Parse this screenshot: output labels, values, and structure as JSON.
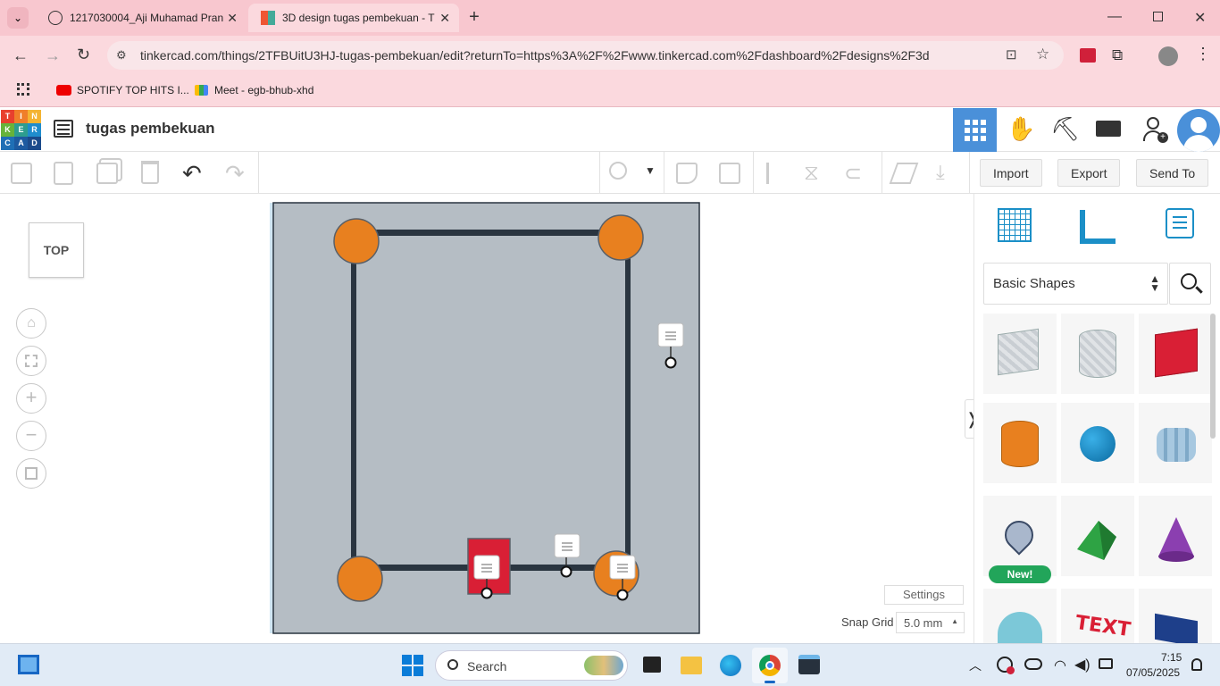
{
  "browser": {
    "tabs": [
      {
        "title": "1217030004_Aji Muhamad Pran",
        "active": false
      },
      {
        "title": "3D design tugas pembekuan - T",
        "active": true
      }
    ],
    "url": "tinkercad.com/things/2TFBUitU3HJ-tugas-pembekuan/edit?returnTo=https%3A%2F%2Fwww.tinkercad.com%2Fdashboard%2Fdesigns%2F3d",
    "bookmarks": [
      {
        "label": "SPOTIFY TOP HITS I...",
        "icon": "youtube-icon"
      },
      {
        "label": "Meet - egb-bhub-xhd",
        "icon": "meet-icon"
      }
    ]
  },
  "app": {
    "logo_letters": [
      "T",
      "I",
      "N",
      "K",
      "E",
      "R",
      "C",
      "A",
      "D"
    ],
    "design_title": "tugas pembekuan",
    "toolbar": {
      "import": "Import",
      "export": "Export",
      "send_to": "Send To"
    }
  },
  "viewcube": {
    "label": "TOP"
  },
  "panel": {
    "library": "Basic Shapes",
    "new_badge": "New!",
    "collapse_arrow": "❭",
    "shapes": [
      "box-hole",
      "cylinder-hole",
      "box",
      "cylinder",
      "sphere",
      "scribble",
      "shape-generator",
      "roof",
      "cone",
      "tube",
      "text",
      "wedge"
    ]
  },
  "workplane": {
    "settings": "Settings",
    "snap_label": "Snap Grid",
    "snap_value": "5.0 mm"
  },
  "taskbar": {
    "search": "Search",
    "time": "7:15",
    "date": "07/05/2025"
  },
  "colors": {
    "accent": "#4a90d9",
    "orange": "#e8801f",
    "red": "#d91f35",
    "frame": "#2a3540",
    "plate": "#b5bdc4"
  }
}
